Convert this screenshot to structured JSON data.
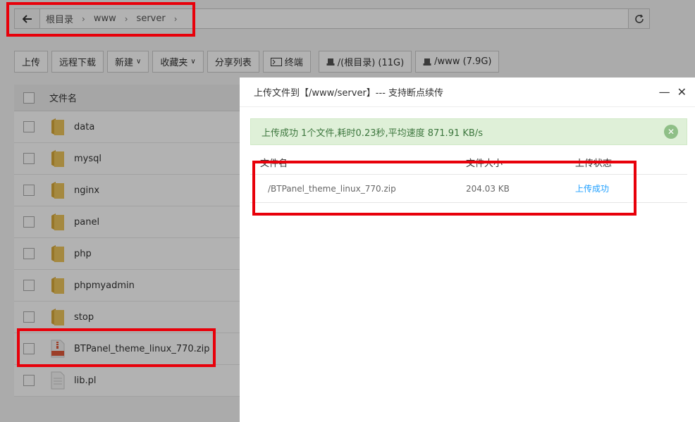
{
  "breadcrumb": {
    "items": [
      "根目录",
      "www",
      "server"
    ]
  },
  "toolbar": {
    "upload": "上传",
    "remote_download": "远程下载",
    "new": "新建",
    "favorites": "收藏夹",
    "share_list": "分享列表",
    "terminal": "终端",
    "disk_root": "/(根目录) (11G)",
    "disk_www": "/www (7.9G)"
  },
  "filelist": {
    "header": "文件名",
    "rows": [
      {
        "name": "data",
        "type": "folder"
      },
      {
        "name": "mysql",
        "type": "folder"
      },
      {
        "name": "nginx",
        "type": "folder"
      },
      {
        "name": "panel",
        "type": "folder"
      },
      {
        "name": "php",
        "type": "folder"
      },
      {
        "name": "phpmyadmin",
        "type": "folder"
      },
      {
        "name": "stop",
        "type": "folder"
      },
      {
        "name": "BTPanel_theme_linux_770.zip",
        "type": "zip"
      },
      {
        "name": "lib.pl",
        "type": "file"
      }
    ]
  },
  "modal": {
    "title": "上传文件到【/www/server】--- 支持断点续传",
    "success_msg": "上传成功 1个文件,耗时0.23秒,平均速度 871.91 KB/s",
    "columns": [
      "文件名",
      "文件大小",
      "上传状态"
    ],
    "rows": [
      {
        "file": "/BTPanel_theme_linux_770.zip",
        "size": "204.03 KB",
        "status": "上传成功"
      }
    ]
  },
  "colors": {
    "highlight": "#e8000a",
    "success_bg": "#dff0d8",
    "success_text": "#3c763d",
    "link": "#20a0ff",
    "folder": "#e8c05a"
  }
}
